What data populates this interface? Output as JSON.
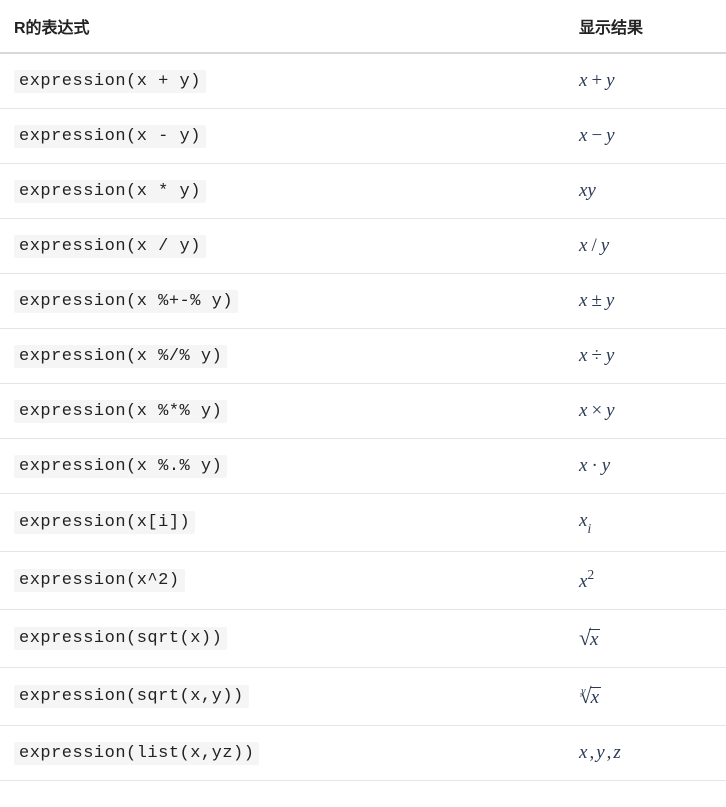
{
  "headers": {
    "col1": "R的表达式",
    "col2": "显示结果"
  },
  "rows": [
    {
      "code": "expression(x + y)",
      "result_kind": "binop",
      "a": "x",
      "b": "y",
      "op": "+"
    },
    {
      "code": "expression(x - y)",
      "result_kind": "binop",
      "a": "x",
      "b": "y",
      "op": "−"
    },
    {
      "code": "expression(x * y)",
      "result_kind": "concat",
      "a": "x",
      "b": "y"
    },
    {
      "code": "expression(x / y)",
      "result_kind": "binop",
      "a": "x",
      "b": "y",
      "op": "/"
    },
    {
      "code": "expression(x %+-% y)",
      "result_kind": "binop",
      "a": "x",
      "b": "y",
      "op": "±"
    },
    {
      "code": "expression(x %/% y)",
      "result_kind": "binop",
      "a": "x",
      "b": "y",
      "op": "÷"
    },
    {
      "code": "expression(x %*% y)",
      "result_kind": "binop",
      "a": "x",
      "b": "y",
      "op": "×"
    },
    {
      "code": "expression(x %.% y)",
      "result_kind": "binop",
      "a": "x",
      "b": "y",
      "op": "·"
    },
    {
      "code": "expression(x[i])",
      "result_kind": "sub",
      "a": "x",
      "b": "i"
    },
    {
      "code": "expression(x^2)",
      "result_kind": "sup",
      "a": "x",
      "b": "2"
    },
    {
      "code": "expression(sqrt(x))",
      "result_kind": "sqrt",
      "a": "x"
    },
    {
      "code": "expression(sqrt(x,y))",
      "result_kind": "nthroot",
      "a": "x",
      "idx": "y"
    },
    {
      "code": "expression(list(x,yz))",
      "result_kind": "list",
      "items": [
        "x",
        "y",
        "z"
      ]
    }
  ]
}
